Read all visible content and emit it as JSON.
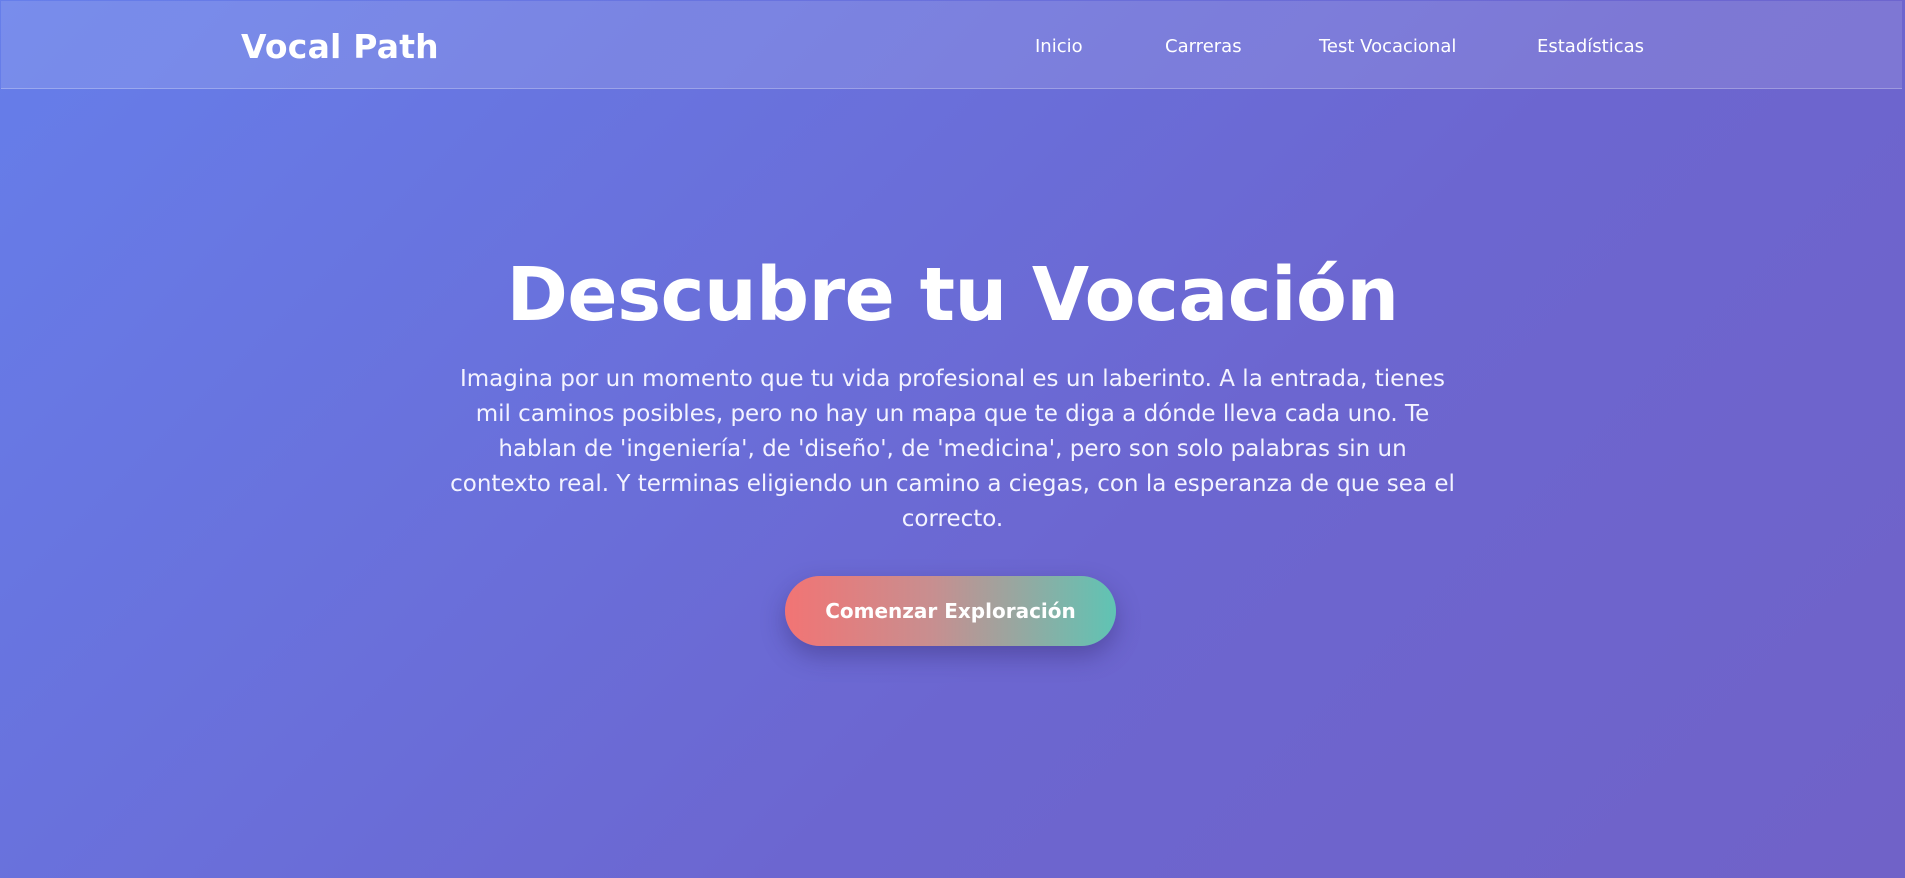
{
  "navbar": {
    "brand": "Vocal Path",
    "links": [
      {
        "label": "Inicio"
      },
      {
        "label": "Carreras"
      },
      {
        "label": "Test Vocacional"
      },
      {
        "label": "Estadísticas"
      }
    ]
  },
  "hero": {
    "title": "Descubre tu Vocación",
    "text": "Imagina por un momento que tu vida profesional es un laberinto. A la entrada, tienes mil caminos posibles, pero no hay un mapa que te diga a dónde lleva cada uno. Te hablan de 'ingeniería', de 'diseño', de 'medicina', pero son solo palabras sin un contexto real. Y terminas eligiendo un camino a ciegas, con la esperanza de que sea el correcto.",
    "cta_label": "Comenzar Exploración"
  },
  "colors": {
    "background_start": "#667eea",
    "background_end": "#764ba2",
    "cta_start": "#f27474",
    "cta_end": "#5fc4b4",
    "text": "#ffffff"
  }
}
